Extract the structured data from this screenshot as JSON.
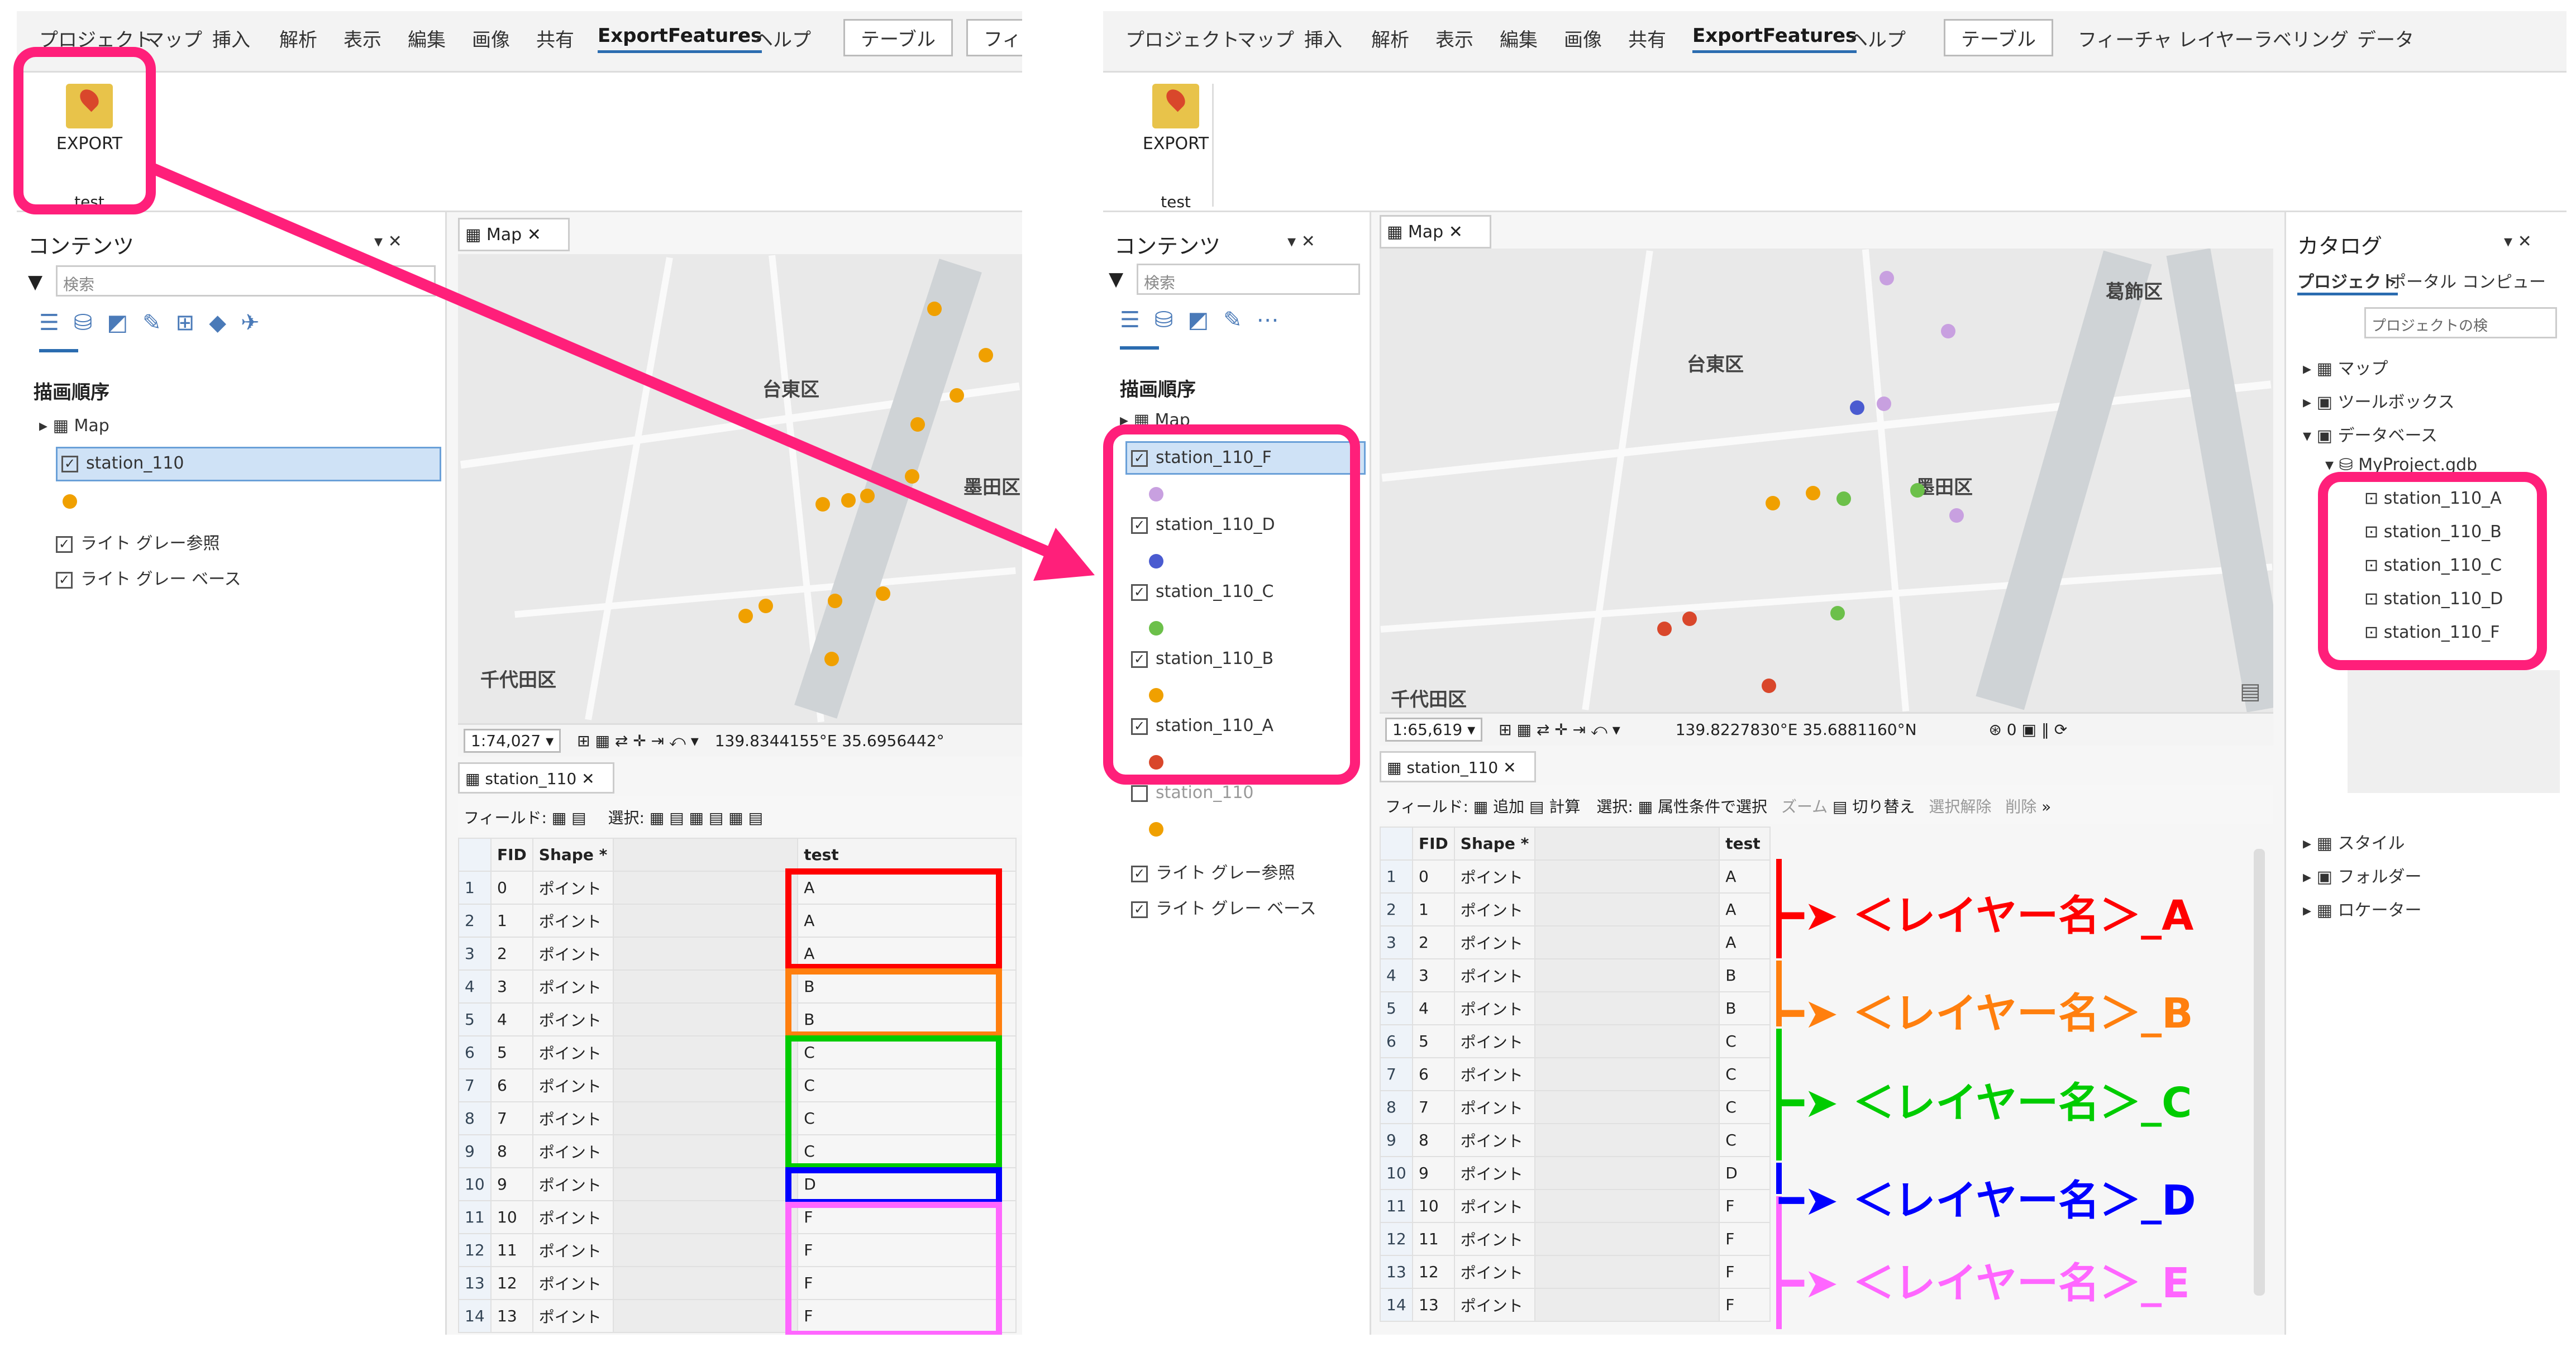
{
  "left": {
    "menu_tabs": [
      "プロジェクト",
      "マップ",
      "挿入",
      "解析",
      "表示",
      "編集",
      "画像",
      "共有",
      "ExportFeatures",
      "ヘルプ"
    ],
    "menu_tabs_boxed": [
      "テーブル",
      "フィーチ"
    ],
    "export_button": "EXPORT",
    "export_group": "test",
    "contents_title": "コンテンツ",
    "search_placeholder": "検索",
    "draw_order": "描画順序",
    "map_item": "Map",
    "layers": [
      "station_110",
      "ライト グレー参照",
      "ライト グレー ベース"
    ],
    "map_tab": "Map",
    "map_labels": [
      "台東区",
      "墨田区",
      "千代田区"
    ],
    "scale": "1:74,027",
    "coords": "139.8344155°E 35.6956442°",
    "table_tab": "station_110",
    "fields_label": "フィールド:",
    "select_label": "選択:",
    "table_headers": [
      "FID",
      "Shape *",
      "",
      "test"
    ],
    "rows": [
      [
        "1",
        "0",
        "ポイント",
        "A"
      ],
      [
        "2",
        "1",
        "ポイント",
        "A"
      ],
      [
        "3",
        "2",
        "ポイント",
        "A"
      ],
      [
        "4",
        "3",
        "ポイント",
        "B"
      ],
      [
        "5",
        "4",
        "ポイント",
        "B"
      ],
      [
        "6",
        "5",
        "ポイント",
        "C"
      ],
      [
        "7",
        "6",
        "ポイント",
        "C"
      ],
      [
        "8",
        "7",
        "ポイント",
        "C"
      ],
      [
        "9",
        "8",
        "ポイント",
        "C"
      ],
      [
        "10",
        "9",
        "ポイント",
        "D"
      ],
      [
        "11",
        "10",
        "ポイント",
        "F"
      ],
      [
        "12",
        "11",
        "ポイント",
        "F"
      ],
      [
        "13",
        "12",
        "ポイント",
        "F"
      ],
      [
        "14",
        "13",
        "ポイント",
        "F"
      ]
    ]
  },
  "right": {
    "menu_tabs": [
      "プロジェクト",
      "マップ",
      "挿入",
      "解析",
      "表示",
      "編集",
      "画像",
      "共有",
      "ExportFeatures",
      "ヘルプ"
    ],
    "menu_tabs_boxed": [
      "テーブル"
    ],
    "menu_tabs_extra": [
      "フィーチャ レイヤー",
      "ラベリング",
      "データ"
    ],
    "export_button": "EXPORT",
    "export_group": "test",
    "contents_title": "コンテンツ",
    "search_placeholder": "検索",
    "draw_order": "描画順序",
    "map_item": "Map",
    "layers": [
      "station_110_F",
      "station_110_D",
      "station_110_C",
      "station_110_B",
      "station_110_A",
      "station_110",
      "ライト グレー参照",
      "ライト グレー ベース"
    ],
    "map_tab": "Map",
    "map_labels": [
      "葛飾区",
      "台東区",
      "墨田区",
      "千代田区"
    ],
    "scale": "1:65,619",
    "coords": "139.8227830°E 35.6881160°N",
    "table_tab": "station_110",
    "fields_label": "フィールド:",
    "tools": [
      "追加",
      "計算",
      "選択:",
      "属性条件で選択",
      "ズーム",
      "切り替え",
      "選択解除",
      "削除"
    ],
    "table_headers": [
      "FID",
      "Shape *",
      "",
      "test"
    ],
    "rows": [
      [
        "1",
        "0",
        "ポイント",
        "A"
      ],
      [
        "2",
        "1",
        "ポイント",
        "A"
      ],
      [
        "3",
        "2",
        "ポイント",
        "A"
      ],
      [
        "4",
        "3",
        "ポイント",
        "B"
      ],
      [
        "5",
        "4",
        "ポイント",
        "B"
      ],
      [
        "6",
        "5",
        "ポイント",
        "C"
      ],
      [
        "7",
        "6",
        "ポイント",
        "C"
      ],
      [
        "8",
        "7",
        "ポイント",
        "C"
      ],
      [
        "9",
        "8",
        "ポイント",
        "C"
      ],
      [
        "10",
        "9",
        "ポイント",
        "D"
      ],
      [
        "11",
        "10",
        "ポイント",
        "F"
      ],
      [
        "12",
        "11",
        "ポイント",
        "F"
      ],
      [
        "13",
        "12",
        "ポイント",
        "F"
      ],
      [
        "14",
        "13",
        "ポイント",
        "F"
      ]
    ],
    "catalog_title": "カタログ",
    "catalog_tabs": [
      "プロジェクト",
      "ポータル",
      "コンピュー"
    ],
    "catalog_search": "プロジェクトの検",
    "catalog_items": [
      "マップ",
      "ツールボックス",
      "データベース",
      "MyProject.gdb"
    ],
    "gdb_items": [
      "station_110_A",
      "station_110_B",
      "station_110_C",
      "station_110_D",
      "station_110_F"
    ],
    "catalog_items2": [
      "スタイル",
      "フォルダー",
      "ロケーター"
    ]
  },
  "annotations": [
    {
      "text": "＜レイヤー名＞_A",
      "color": "#ff0000"
    },
    {
      "text": "＜レイヤー名＞_B",
      "color": "#ff7f0e"
    },
    {
      "text": "＜レイヤー名＞_C",
      "color": "#00cc00"
    },
    {
      "text": "＜レイヤー名＞_D",
      "color": "#0000ff"
    },
    {
      "text": "＜レイヤー名＞_E",
      "color": "#ff66ff"
    }
  ],
  "colors": {
    "highlight": "#ff1f7a",
    "A": "#ff0000",
    "B": "#ff7f0e",
    "C": "#00cc00",
    "D": "#0000ff",
    "F": "#ff66ff",
    "orange_dot": "#f0a000",
    "purple_dot": "#c8a0e0"
  }
}
